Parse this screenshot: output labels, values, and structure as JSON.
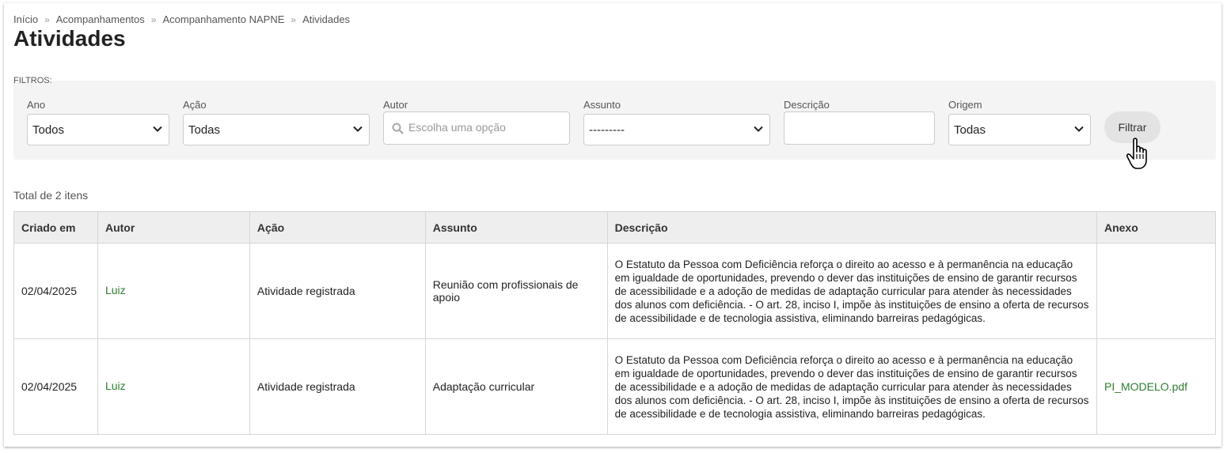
{
  "breadcrumb": [
    "Início",
    "Acompanhamentos",
    "Acompanhamento NAPNE",
    "Atividades"
  ],
  "page_title": "Atividades",
  "filters": {
    "legend": "FILTROS:",
    "ano": {
      "label": "Ano",
      "value": "Todos"
    },
    "acao": {
      "label": "Ação",
      "value": "Todas"
    },
    "autor": {
      "label": "Autor",
      "placeholder": "Escolha uma opção"
    },
    "assunto": {
      "label": "Assunto",
      "value": "---------"
    },
    "descricao": {
      "label": "Descrição",
      "value": ""
    },
    "origem": {
      "label": "Origem",
      "value": "Todas"
    },
    "button": "Filtrar"
  },
  "total": "Total de 2 itens",
  "table": {
    "headers": [
      "Criado em",
      "Autor",
      "Ação",
      "Assunto",
      "Descrição",
      "Anexo"
    ],
    "rows": [
      {
        "criado_em": "02/04/2025",
        "autor": "Luiz",
        "acao": "Atividade registrada",
        "assunto": "Reunião com profissionais de apoio",
        "descricao": "O Estatuto da Pessoa com Deficiência reforça o direito ao acesso e à permanência na educação em igualdade de oportunidades, prevendo o dever das instituições de ensino de garantir recursos de acessibilidade e a adoção de medidas de adaptação curricular para atender às necessidades dos alunos com deficiência. - O art. 28, inciso I, impõe às instituições de ensino a oferta de recursos de acessibilidade e de tecnologia assistiva, eliminando barreiras pedagógicas.",
        "anexo": ""
      },
      {
        "criado_em": "02/04/2025",
        "autor": "Luiz",
        "acao": "Atividade registrada",
        "assunto": "Adaptação curricular",
        "descricao": "O Estatuto da Pessoa com Deficiência reforça o direito ao acesso e à permanência na educação em igualdade de oportunidades, prevendo o dever das instituições de ensino de garantir recursos de acessibilidade e a adoção de medidas de adaptação curricular para atender às necessidades dos alunos com deficiência. - O art. 28, inciso I, impõe às instituições de ensino a oferta de recursos de acessibilidade e de tecnologia assistiva, eliminando barreiras pedagógicas.",
        "anexo": "PI_MODELO.pdf"
      }
    ]
  },
  "colors": {
    "link": "#2e7d32",
    "filter_bg": "#f4f4f4",
    "header_bg": "#eeeeee"
  }
}
